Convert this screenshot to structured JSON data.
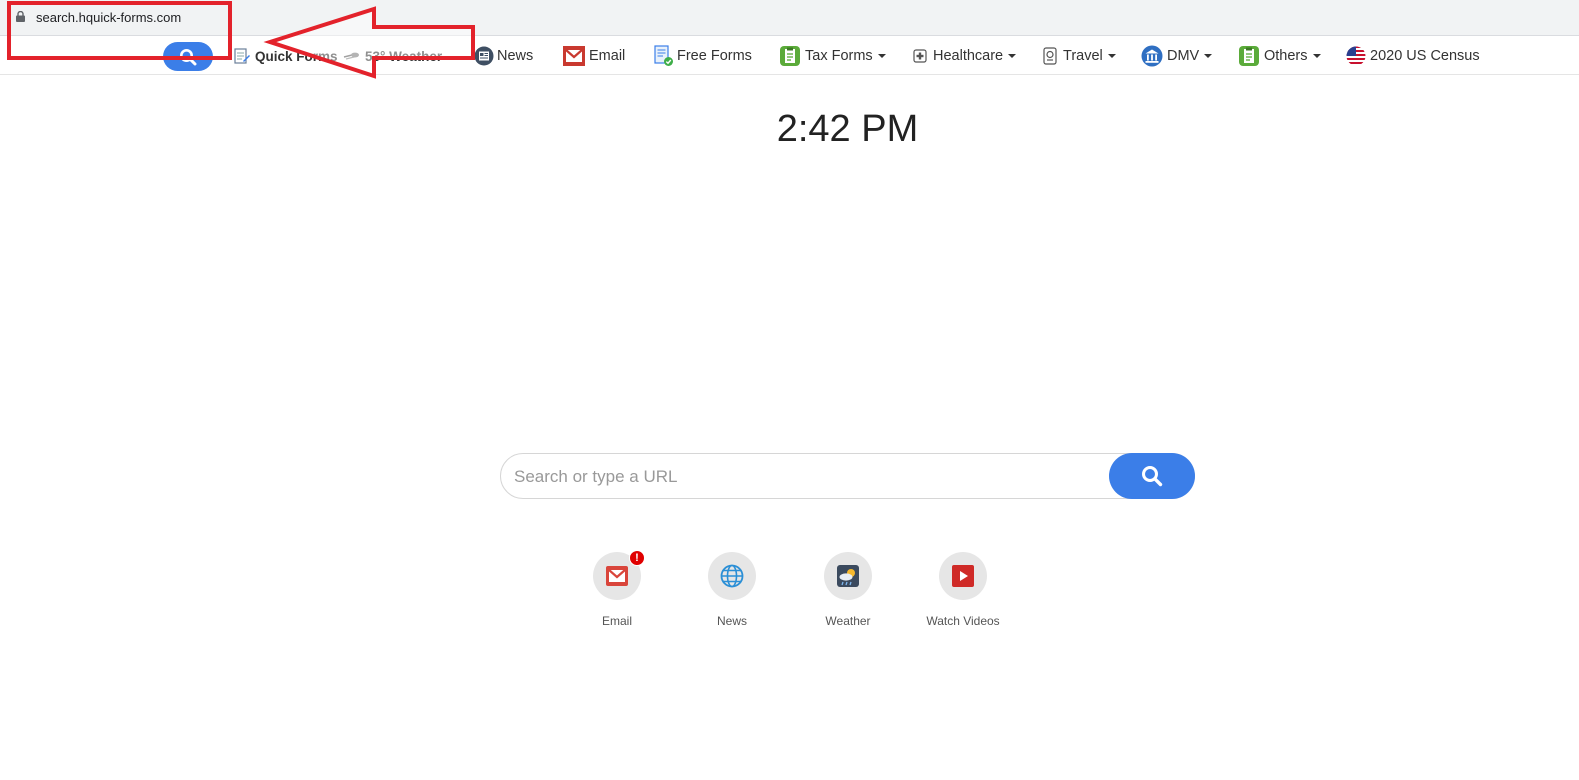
{
  "browser": {
    "url": "search.hquick-forms.com"
  },
  "navbar": {
    "quick_forms": "Quick Forms",
    "weather": "53° Weather",
    "news": "News",
    "email": "Email",
    "free_forms": "Free Forms",
    "tax_forms": "Tax Forms",
    "healthcare": "Healthcare",
    "travel": "Travel",
    "dmv": "DMV",
    "others": "Others",
    "census": "2020 US Census"
  },
  "main": {
    "clock": "2:42 PM",
    "search_placeholder": "Search or type a URL",
    "tiles": [
      {
        "label": "Email",
        "icon": "email-icon",
        "badge": "!"
      },
      {
        "label": "News",
        "icon": "globe-icon"
      },
      {
        "label": "Weather",
        "icon": "weather-icon"
      },
      {
        "label": "Watch Videos",
        "icon": "play-icon"
      }
    ]
  },
  "colors": {
    "accent": "#3b7ee8",
    "annotation": "#e3222b",
    "badge": "#e00000"
  }
}
